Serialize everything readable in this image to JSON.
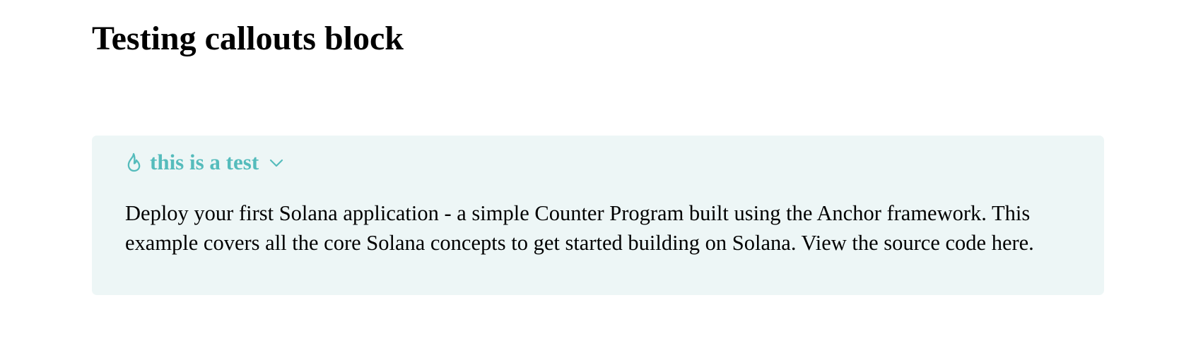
{
  "page": {
    "title": "Testing callouts block"
  },
  "callout": {
    "icon": "flame-icon",
    "title": "this is a test",
    "toggle_icon": "chevron-down-icon",
    "body": "Deploy your first Solana application - a simple Counter Program built using the Anchor framework. This example covers all the core Solana concepts to get started building on Solana. View the source code here.",
    "accent_color": "#55bcbc",
    "background_color": "#edf6f6"
  }
}
